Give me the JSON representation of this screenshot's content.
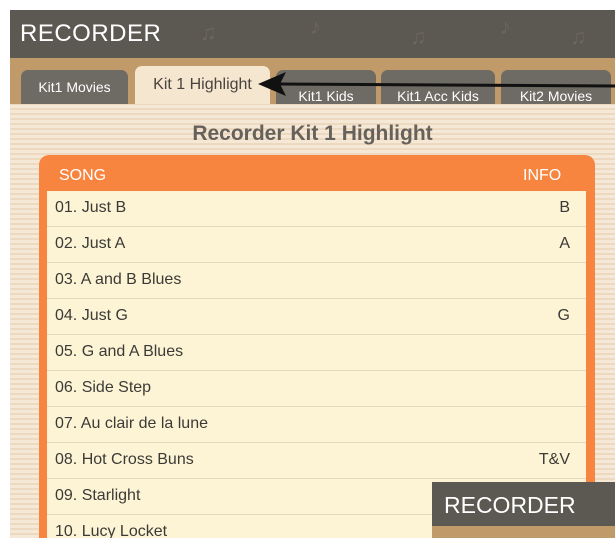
{
  "app": {
    "title": "RECORDER"
  },
  "tabs": [
    {
      "label": "Kit1 Movies",
      "active": false
    },
    {
      "label": "Kit 1 Highlight",
      "active": true
    },
    {
      "label": "Kit1 Kids",
      "active": false
    },
    {
      "label": "Kit1 Acc Kids",
      "active": false
    },
    {
      "label": "Kit2 Movies",
      "active": false
    }
  ],
  "page": {
    "heading": "Recorder Kit 1 Highlight"
  },
  "list": {
    "header_song": "SONG",
    "header_info": "INFO",
    "rows": [
      {
        "song": "01. Just B",
        "info": "B"
      },
      {
        "song": "02. Just A",
        "info": "A"
      },
      {
        "song": "03. A and B Blues",
        "info": ""
      },
      {
        "song": "04. Just G",
        "info": "G"
      },
      {
        "song": "05. G and A Blues",
        "info": ""
      },
      {
        "song": "06. Side Step",
        "info": ""
      },
      {
        "song": "07. Au clair de la lune",
        "info": ""
      },
      {
        "song": "08. Hot Cross Buns",
        "info": "T&V"
      },
      {
        "song": "09. Starlight",
        "info": ""
      },
      {
        "song": "10. Lucy Locket",
        "info": ""
      }
    ]
  },
  "inset": {
    "title": "RECORDER"
  },
  "colors": {
    "titlebar": "#5c5852",
    "tabstrip": "#c09a68",
    "active_tab": "#f4e6cf",
    "panel_accent": "#f7853f",
    "row_bg": "#fdf4d6"
  }
}
